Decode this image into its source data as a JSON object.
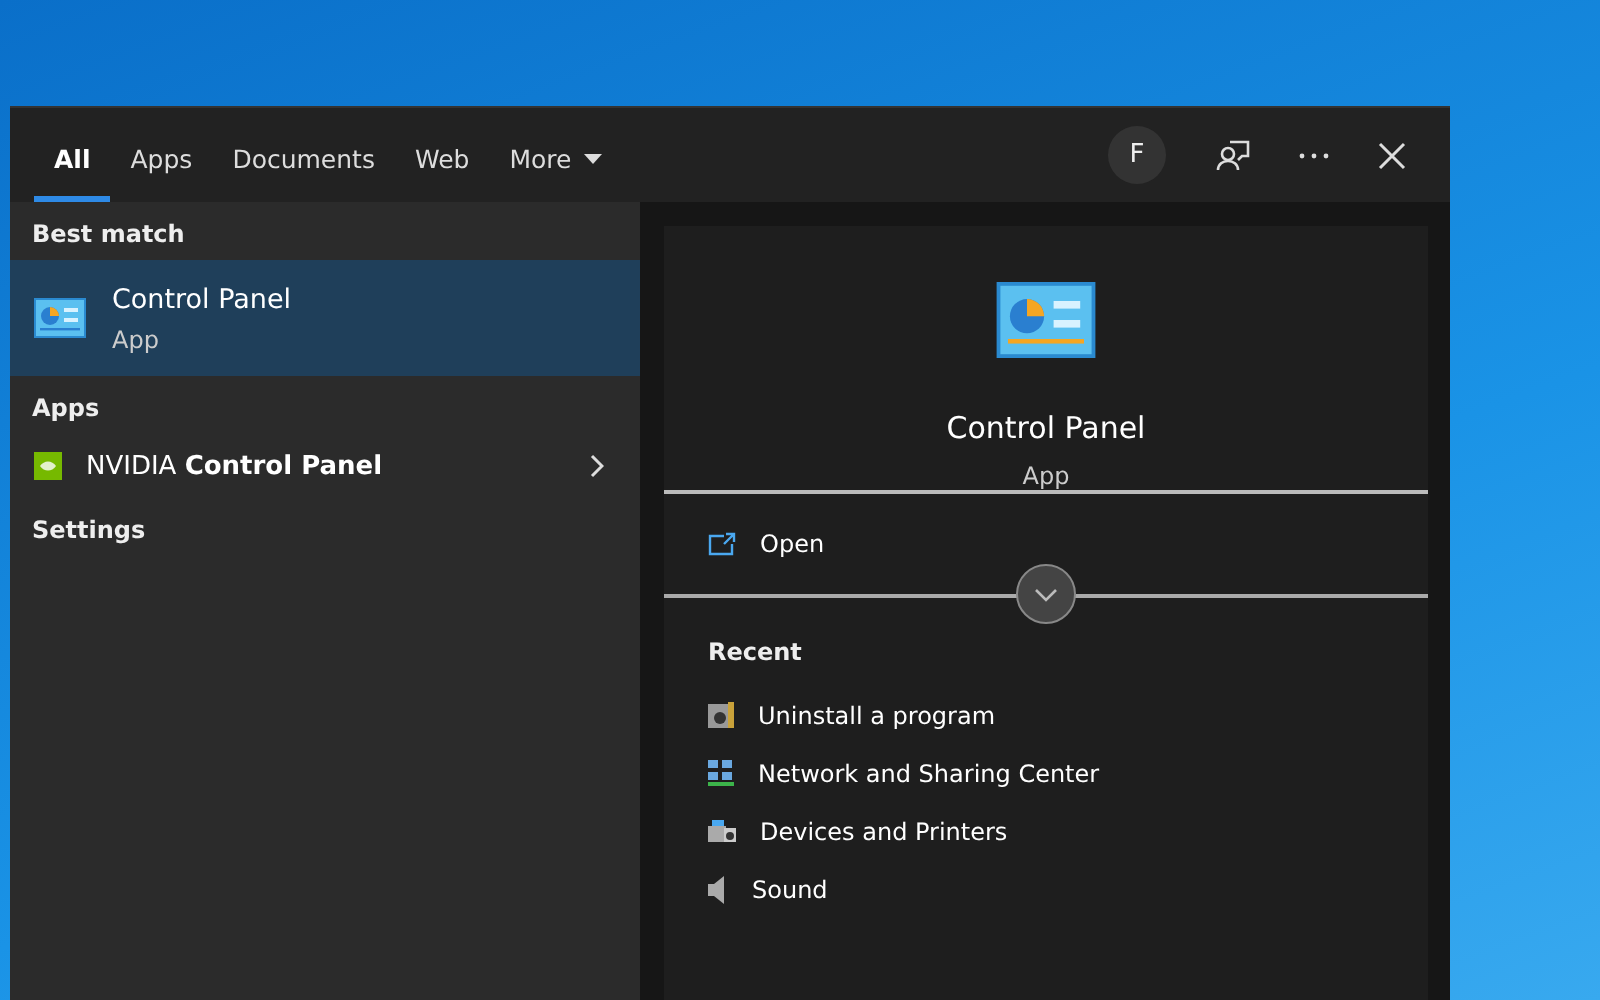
{
  "tabs": [
    {
      "label": "All",
      "selected": true
    },
    {
      "label": "Apps",
      "selected": false
    },
    {
      "label": "Documents",
      "selected": false
    },
    {
      "label": "Web",
      "selected": false
    },
    {
      "label": "More",
      "selected": false,
      "dropdown": true
    }
  ],
  "header_actions": {
    "avatar_letter": "F"
  },
  "results": [
    {
      "kind": "heading",
      "label": "Best match"
    },
    {
      "kind": "best",
      "title": "Control Panel",
      "subtitle": "App",
      "selected": true
    },
    {
      "kind": "heading",
      "label": "Apps"
    },
    {
      "kind": "app",
      "title": "NVIDIA **Control Panel**",
      "selected": false
    },
    {
      "kind": "heading",
      "label": "Settings"
    }
  ],
  "preview": {
    "title": "Control Panel",
    "subtitle": "App",
    "open_label": "Open",
    "recent_heading": "Recent",
    "recent": [
      {
        "label": "Uninstall a program",
        "kind": "program"
      },
      {
        "label": "Network and Sharing Center",
        "kind": "network"
      },
      {
        "label": "Devices and Printers",
        "kind": "devices"
      },
      {
        "label": "Sound",
        "kind": "sound"
      }
    ]
  }
}
